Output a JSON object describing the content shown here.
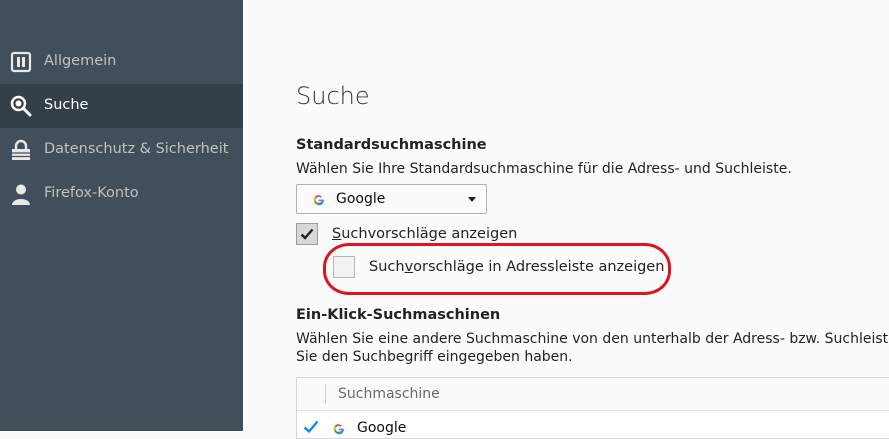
{
  "sidebar": {
    "items": [
      {
        "label": "Allgemein",
        "icon": "general-page-icon",
        "active": false
      },
      {
        "label": "Suche",
        "icon": "search-icon",
        "active": true
      },
      {
        "label": "Datenschutz & Sicherheit",
        "icon": "lock-icon",
        "active": false
      },
      {
        "label": "Firefox-Konto",
        "icon": "account-icon",
        "active": false
      }
    ]
  },
  "main": {
    "title": "Suche",
    "default_engine": {
      "heading": "Standardsuchmaschine",
      "description": "Wählen Sie Ihre Standardsuchmaschine für die Adress- und Suchleiste.",
      "selected": "Google"
    },
    "suggestions": {
      "show_label_pre": "",
      "show_label_accesskey": "S",
      "show_label_post": "uchvorschläge anzeigen",
      "show_checked": true,
      "urlbar_label_pre": "Such",
      "urlbar_label_accesskey": "v",
      "urlbar_label_post": "orschläge in Adressleiste anzeigen",
      "urlbar_checked": false
    },
    "one_click": {
      "heading": "Ein-Klick-Suchmaschinen",
      "description_line1": "Wählen Sie eine andere Suchmaschine von den unterhalb der Adress- bzw. Suchleiste",
      "description_line2": "Sie den Suchbegriff eingegeben haben.",
      "column_header": "Suchmaschine",
      "rows": [
        {
          "name": "Google",
          "checked": true
        }
      ]
    }
  },
  "colors": {
    "sidebar_bg": "#424f5a",
    "sidebar_active_bg": "#343f48",
    "highlight": "#e0141e",
    "check_blue": "#0a84ff"
  }
}
